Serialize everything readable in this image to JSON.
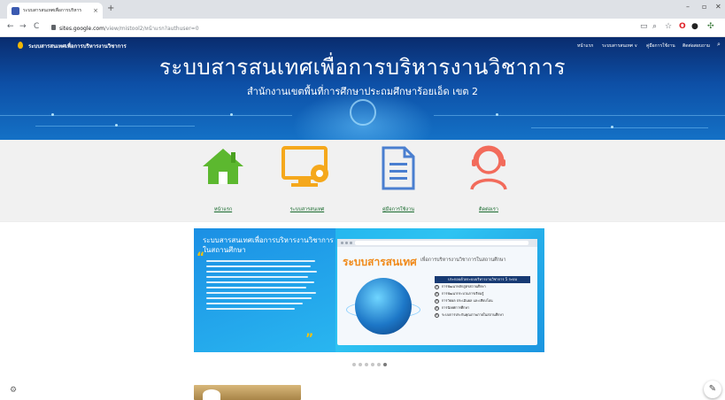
{
  "browser": {
    "tab_title": "ระบบสารสนเทศเพื่อการบริหาร",
    "tab_close": "×",
    "new_tab": "+",
    "minimize": "–",
    "maximize": "▫",
    "close": "✕",
    "back": "←",
    "forward": "→",
    "reload": "C",
    "url_host": "sites.google.com",
    "url_path": "/view/mistool2/หน้าแรก?authuser=0"
  },
  "site": {
    "name": "ระบบสารสนเทศเพื่อการบริหารงานวิชาการ",
    "nav": [
      "หน้าแรก",
      "ระบบสารสนเทศ ∨",
      "คู่มือการใช้งาน",
      "ติดต่อสอบถาม"
    ],
    "title": "ระบบสารสนเทศเพื่อการบริหารงานวิชาการ",
    "subtitle": "สำนักงานเขตพื้นที่การศึกษาประถมศึกษาร้อยเอ็ด เขต 2"
  },
  "icon_links": [
    {
      "label": "หน้าแรก",
      "icon": "home-icon",
      "color": "#5cb82f"
    },
    {
      "label": "ระบบสารสนเทศ",
      "icon": "monitor-gear-icon",
      "color": "#f5a81c"
    },
    {
      "label": "คู่มือการใช้งาน",
      "icon": "document-icon",
      "color": "#4a7fd0"
    },
    {
      "label": "ติดต่อเรา",
      "icon": "support-agent-icon",
      "color": "#f26b5b"
    }
  ],
  "carousel": {
    "headline": "ระบบสารสนเทศเพื่อการบริหารงานวิชาการในสถานศึกษา",
    "brand": "ระบบสารสนเทศ",
    "tagline": "เพื่อการบริหารงานวิชาการในสถานศึกษา",
    "menu_title": "ประกอบด้วยระบบบริหารงานวิชาการ 5 ระบบ",
    "menu_items": [
      "การพัฒนาหลักสูตรสถานศึกษา",
      "การพัฒนากระบวนการเรียนรู้",
      "การวัดผล ประเมินผล และเทียบโอน",
      "การนิเทศการศึกษา",
      "ระบบการประกันคุณภาพภายในสถานศึกษา"
    ],
    "slide_count": 6,
    "active_slide": 6
  },
  "colors": {
    "hero_top": "#0a2c6e",
    "hero_bottom": "#1471c6",
    "link_green": "#1a6b2f",
    "slide_blue": "#1aa8ea",
    "brand_orange": "#f08a1a"
  },
  "fab": {
    "settings": "⚙",
    "edit": "✎"
  }
}
